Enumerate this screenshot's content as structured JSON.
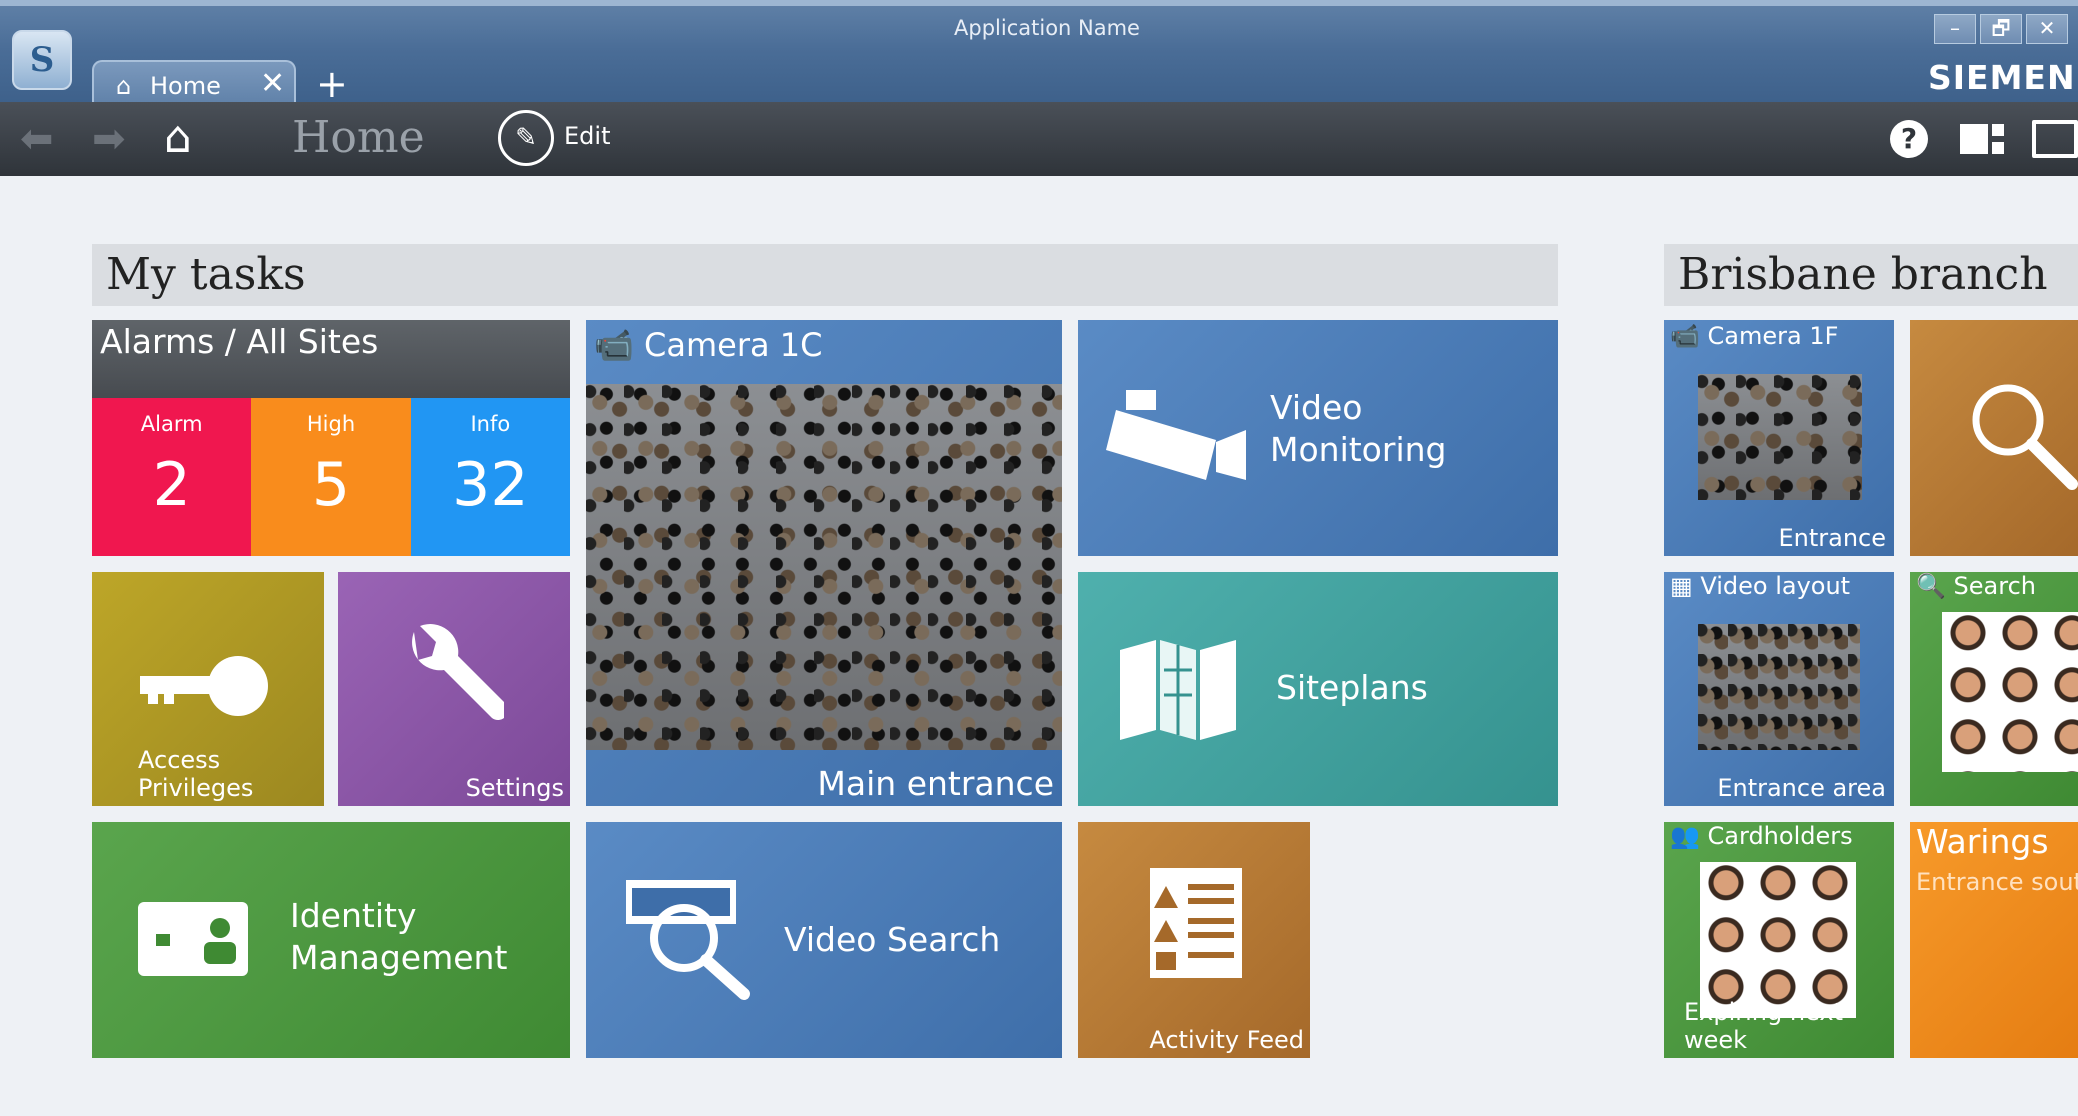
{
  "window": {
    "title": "Application Name",
    "brand": "SIEMENS",
    "controls": [
      "–",
      "🗗",
      "✕"
    ]
  },
  "tabs": {
    "home_label": "Home",
    "close_glyph": "✕",
    "add_glyph": "+"
  },
  "toolbar": {
    "page_title": "Home",
    "edit_label": "Edit",
    "help_glyph": "?"
  },
  "sections": {
    "my_tasks": "My tasks",
    "brisbane": "Brisbane branch"
  },
  "tiles": {
    "alarms": {
      "title": "Alarms / All Sites",
      "counters": [
        {
          "label": "Alarm",
          "value": "2",
          "color": "#f0174f"
        },
        {
          "label": "High",
          "value": "5",
          "color": "#f98c1c"
        },
        {
          "label": "Info",
          "value": "32",
          "color": "#2196f3"
        }
      ]
    },
    "camera_1c": {
      "title": "Camera 1C",
      "caption": "Main entrance"
    },
    "video_monitoring": {
      "line1": "Video",
      "line2": "Monitoring"
    },
    "access_privileges": {
      "label": "Access Privileges"
    },
    "settings": {
      "label": "Settings"
    },
    "siteplans": {
      "label": "Siteplans"
    },
    "identity_management": {
      "line1": "Identity",
      "line2": "Management"
    },
    "video_search": {
      "label": "Video Search"
    },
    "activity_feed": {
      "label": "Activity Feed"
    },
    "camera_1f": {
      "title": "Camera 1F",
      "caption": "Entrance"
    },
    "video_layout": {
      "title": "Video layout",
      "caption": "Entrance area"
    },
    "search": {
      "title": "Search"
    },
    "cardholders": {
      "title": "Cardholders",
      "caption": "Expiring next week"
    },
    "warnings": {
      "title": "Warings",
      "caption": "Entrance south"
    }
  }
}
